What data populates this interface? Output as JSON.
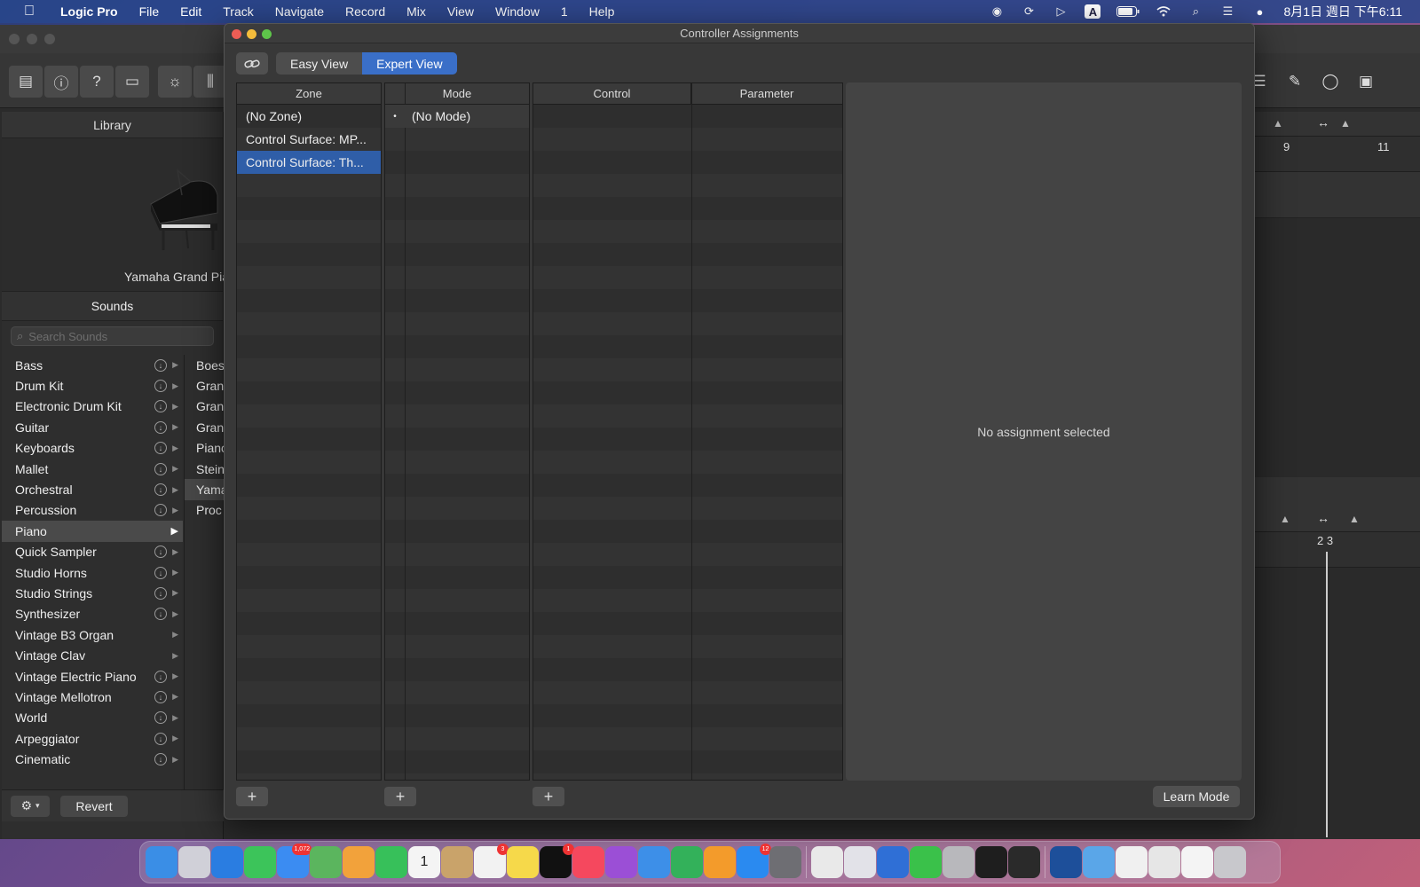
{
  "menubar": {
    "app_name": "Logic Pro",
    "items": [
      "File",
      "Edit",
      "Track",
      "Navigate",
      "Record",
      "Mix",
      "View",
      "Window",
      "1",
      "Help"
    ],
    "clock": "8月1日 週日 下午6:11",
    "status_icons": [
      "logic-remote-icon",
      "sync-icon",
      "play-circle-icon",
      "input-source-icon",
      "battery-icon",
      "wifi-icon",
      "spotlight-icon",
      "control-center-icon",
      "siri-icon"
    ],
    "input_source_label": "A"
  },
  "library": {
    "title": "Library",
    "preview_name": "Yamaha Grand Piano",
    "sounds_title": "Sounds",
    "search_placeholder": "Search Sounds",
    "categories": [
      {
        "label": "Bass",
        "download": true
      },
      {
        "label": "Drum Kit",
        "download": true
      },
      {
        "label": "Electronic Drum Kit",
        "download": true
      },
      {
        "label": "Guitar",
        "download": true
      },
      {
        "label": "Keyboards",
        "download": true
      },
      {
        "label": "Mallet",
        "download": true
      },
      {
        "label": "Orchestral",
        "download": true
      },
      {
        "label": "Percussion",
        "download": true
      },
      {
        "label": "Piano",
        "download": false,
        "selected": true
      },
      {
        "label": "Quick Sampler",
        "download": true
      },
      {
        "label": "Studio Horns",
        "download": true
      },
      {
        "label": "Studio Strings",
        "download": true
      },
      {
        "label": "Synthesizer",
        "download": true
      },
      {
        "label": "Vintage B3 Organ",
        "download": false
      },
      {
        "label": "Vintage Clav",
        "download": false
      },
      {
        "label": "Vintage Electric Piano",
        "download": true
      },
      {
        "label": "Vintage Mellotron",
        "download": true
      },
      {
        "label": "World",
        "download": true
      },
      {
        "label": "Arpeggiator",
        "download": true
      },
      {
        "label": "Cinematic",
        "download": true
      }
    ],
    "subitems": [
      "Boes",
      "Gran",
      "Gran",
      "Gran",
      "Pianc",
      "Stein",
      "Yama",
      "Proc"
    ],
    "subitem_selected_index": 6,
    "revert_label": "Revert"
  },
  "tracks": {
    "ruler_top": [
      "9",
      "11"
    ],
    "ruler_bottom": "2 3"
  },
  "dialog": {
    "title": "Controller Assignments",
    "easy_view_label": "Easy View",
    "expert_view_label": "Expert View",
    "active_view": "Expert View",
    "columns": {
      "zone": "Zone",
      "mode": "Mode",
      "control": "Control",
      "parameter": "Parameter"
    },
    "zones": [
      {
        "label": "(No Zone)",
        "selected": false
      },
      {
        "label": "Control Surface: MP...",
        "selected": false
      },
      {
        "label": "Control Surface: Th...",
        "selected": true
      }
    ],
    "modes": [
      {
        "label": "(No Mode)",
        "marker": "•"
      }
    ],
    "detail_text": "No assignment selected",
    "add_label": "+",
    "learn_mode_label": "Learn Mode"
  },
  "dock": {
    "apps": [
      {
        "name": "finder-icon",
        "color": "#3a8ee6"
      },
      {
        "name": "launchpad-icon",
        "color": "#d0d0d8"
      },
      {
        "name": "safari-icon",
        "color": "#2a7de1"
      },
      {
        "name": "messages-icon",
        "color": "#3cc45a"
      },
      {
        "name": "mail-icon",
        "color": "#3b8cf2",
        "badge": "1,072"
      },
      {
        "name": "maps-icon",
        "color": "#5bb55e"
      },
      {
        "name": "photos-icon",
        "color": "#f2a23b"
      },
      {
        "name": "facetime-icon",
        "color": "#37c05a"
      },
      {
        "name": "calendar-icon",
        "color": "#f4f4f4",
        "text": "1"
      },
      {
        "name": "notes-app-icon",
        "color": "#c9a36a"
      },
      {
        "name": "reminders-icon",
        "color": "#f2f2f2",
        "badge": "3"
      },
      {
        "name": "notes-icon",
        "color": "#f6d94a"
      },
      {
        "name": "apple-tv-icon",
        "color": "#111111",
        "badge": "1"
      },
      {
        "name": "music-icon",
        "color": "#f5485e"
      },
      {
        "name": "podcasts-icon",
        "color": "#9b4fd6"
      },
      {
        "name": "keynote-icon",
        "color": "#3d8fe8"
      },
      {
        "name": "numbers-icon",
        "color": "#33b15a"
      },
      {
        "name": "pages-icon",
        "color": "#f39b2b"
      },
      {
        "name": "app-store-icon",
        "color": "#2a8af0",
        "badge": "12"
      },
      {
        "name": "system-preferences-icon",
        "color": "#6e6e73"
      },
      {
        "name": "chrome-icon",
        "color": "#e9e9e9"
      },
      {
        "name": "network-icon",
        "color": "#e2e2e8"
      },
      {
        "name": "sync-app-icon",
        "color": "#2f6fd6"
      },
      {
        "name": "line-icon",
        "color": "#3ac14a"
      },
      {
        "name": "disk-utility-icon",
        "color": "#b8b8bc"
      },
      {
        "name": "logic-pro-icon",
        "color": "#1e1e1e"
      },
      {
        "name": "piano-app-icon",
        "color": "#2a2a2a"
      },
      {
        "name": "mainstage-icon",
        "color": "#1d4f9a"
      },
      {
        "name": "folder-icon",
        "color": "#5aa6e8"
      },
      {
        "name": "document-icon",
        "color": "#f0f0f0"
      },
      {
        "name": "document-icon-2",
        "color": "#e6e6e6"
      },
      {
        "name": "notepad-icon",
        "color": "#f4f4f4"
      },
      {
        "name": "trash-icon",
        "color": "#c8c8cc"
      }
    ]
  }
}
